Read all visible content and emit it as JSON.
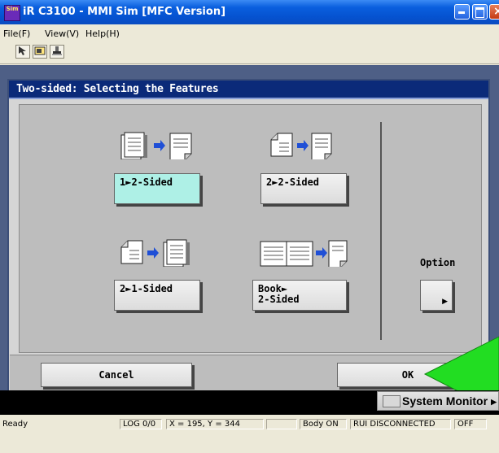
{
  "window": {
    "title": "iR C3100 - MMI Sim [MFC Version]",
    "icon_text": "Sim"
  },
  "menu": [
    "File(F)",
    "View(V)",
    "Help(H)"
  ],
  "toolbar": {
    "icons": [
      "pointer-icon",
      "image-icon",
      "stamp-icon"
    ]
  },
  "dialog": {
    "title": "Two-sided: Selecting the Features",
    "features": [
      {
        "label": "1►2-Sided",
        "selected": true
      },
      {
        "label": "2►2-Sided",
        "selected": false
      },
      {
        "label": "2►1-Sided",
        "selected": false
      },
      {
        "label": "Book►\n2-Sided",
        "selected": false
      }
    ],
    "option_label": "Option",
    "cancel_label": "Cancel",
    "ok_label": "OK"
  },
  "system_monitor": {
    "label": "System Monitor"
  },
  "status": {
    "ready": "Ready",
    "log": "LOG 0/0",
    "coords": "X =  195, Y =  344",
    "blank": "",
    "body": "Body ON",
    "rui": "RUI DISCONNECTED",
    "power": "OFF"
  },
  "colors": {
    "selected_button": "#aef0e6",
    "dialog_header": "#0b2a79",
    "arrow_green": "#22dd22"
  }
}
